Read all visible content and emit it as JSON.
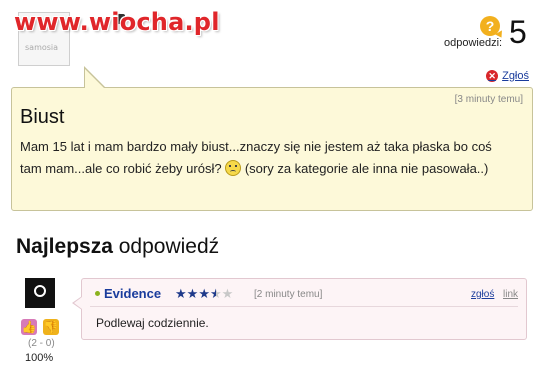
{
  "watermark": {
    "text": "www.wiocha.pl"
  },
  "avatar": {
    "name": "samosia"
  },
  "answers": {
    "label": "odpowiedzi:",
    "count": "5",
    "icon": "question-bubble-icon"
  },
  "report": {
    "label": "Zgłoś",
    "icon": "close-icon"
  },
  "question": {
    "time": "[3 minuty temu]",
    "title": "Biust",
    "body_part1": "Mam 15 lat i mam bardzo mały biust...znaczy się nie jestem aż taka płaska bo coś tam mam...ale co robić żeby urósł?",
    "body_part2": "(sory za kategorie ale inna nie pasowała..)",
    "emoji": "worried-face-icon"
  },
  "best_answer": {
    "heading_bold": "Najlepsza",
    "heading_rest": "odpowiedź",
    "user": "Evidence",
    "rating": {
      "value": 3.5,
      "max": 5
    },
    "time": "[2 minuty temu]",
    "report_label": "zgłoś",
    "link_label": "link",
    "text": "Podlewaj codziennie.",
    "votes": "(2 - 0)",
    "percent": "100%",
    "status_color": "#8bb21e"
  }
}
